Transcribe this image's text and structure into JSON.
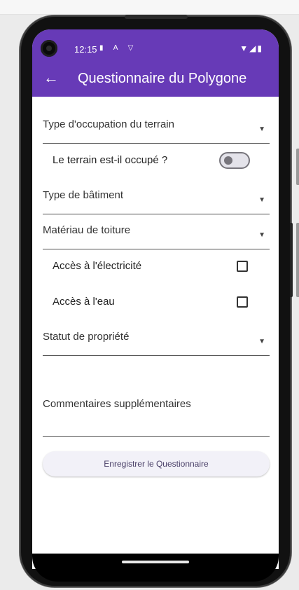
{
  "status_bar": {
    "time": "12:15",
    "left_icons": "▮ A ▽",
    "right_icons": "▼◢▮"
  },
  "app_bar": {
    "back_icon": "←",
    "title": "Questionnaire du Polygone",
    "color": "#673ab7"
  },
  "form": {
    "occupation_type": {
      "label": "Type d'occupation du terrain",
      "arrow": "▼"
    },
    "occupied_toggle": {
      "label": "Le terrain est-il occupé ?",
      "checked": false
    },
    "building_type": {
      "label": "Type de bâtiment",
      "arrow": "▼"
    },
    "roof_material": {
      "label": "Matériau de toiture",
      "arrow": "▼"
    },
    "electricity": {
      "label": "Accès à l'électricité",
      "checked": false
    },
    "water": {
      "label": "Accès à l'eau",
      "checked": false
    },
    "ownership": {
      "label": "Statut de propriété",
      "arrow": "▼"
    },
    "comments": {
      "label": "Commentaires supplémentaires"
    },
    "save_label": "Enregistrer le Questionnaire"
  }
}
